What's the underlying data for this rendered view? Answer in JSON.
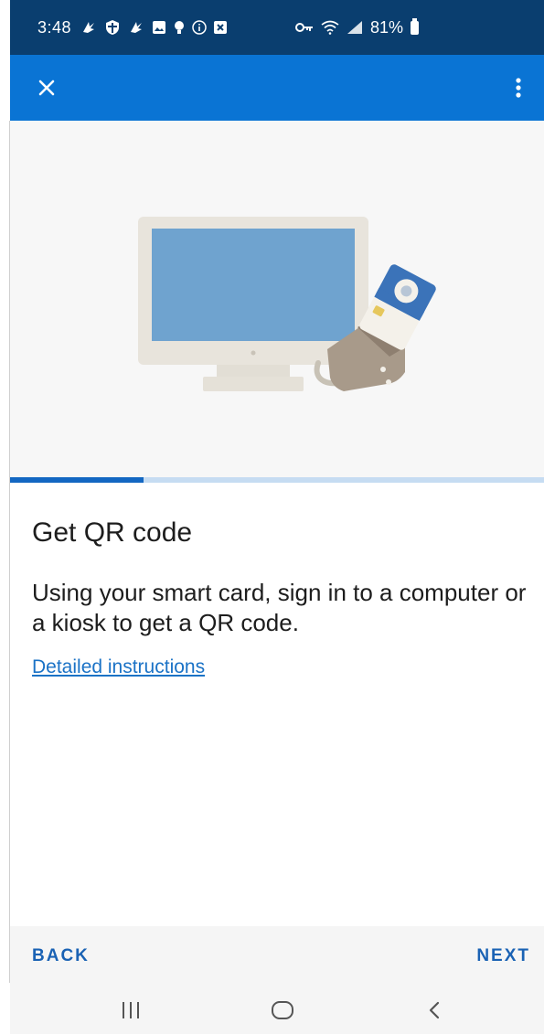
{
  "status_bar": {
    "time": "3:48",
    "battery": "81%",
    "icons": [
      "notification-icon",
      "shield-icon",
      "notification-icon",
      "image-icon",
      "location-icon",
      "info-icon",
      "close-box-icon",
      "vpn-key-icon",
      "wifi-icon",
      "signal-icon",
      "battery-icon"
    ]
  },
  "app_bar": {
    "close_icon": "close-icon",
    "menu_icon": "more-vertical-icon"
  },
  "progress": {
    "value": 0.25,
    "fill_color": "#1367c2",
    "track_color": "#c6dcf2"
  },
  "content": {
    "title": "Get QR code",
    "body": "Using your smart card, sign in to a computer or a kiosk to get a QR code.",
    "link": "Detailed instructions"
  },
  "actions": {
    "back": "BACK",
    "next": "NEXT"
  },
  "colors": {
    "status_bar": "#0a3e6f",
    "app_bar": "#0a74d4",
    "accent": "#1a62b4"
  }
}
